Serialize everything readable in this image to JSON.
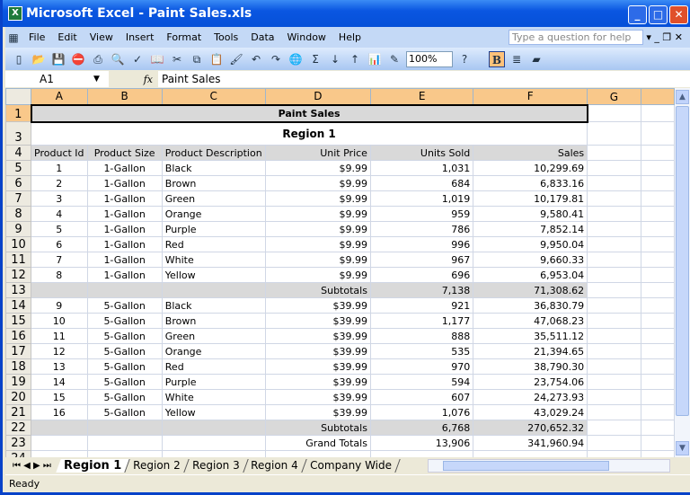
{
  "window": {
    "title": "Microsoft Excel - Paint Sales.xls"
  },
  "menu": [
    "File",
    "Edit",
    "View",
    "Insert",
    "Format",
    "Tools",
    "Data",
    "Window",
    "Help"
  ],
  "help_placeholder": "Type a question for help",
  "toolbar": {
    "zoom": "100%",
    "bold": "B"
  },
  "formula_bar": {
    "name_box": "A1",
    "fx": "fx",
    "content": "Paint Sales"
  },
  "columns": [
    "A",
    "B",
    "C",
    "D",
    "E",
    "F",
    "G"
  ],
  "sheet": {
    "title": "Paint Sales",
    "subtitle": "Region 1",
    "headers": [
      "Product Id",
      "Product Size",
      "Product Description",
      "Unit Price",
      "Units Sold",
      "Sales"
    ],
    "rows": [
      [
        "1",
        "1-Gallon",
        "Black",
        "$9.99",
        "1,031",
        "10,299.69"
      ],
      [
        "2",
        "1-Gallon",
        "Brown",
        "$9.99",
        "684",
        "6,833.16"
      ],
      [
        "3",
        "1-Gallon",
        "Green",
        "$9.99",
        "1,019",
        "10,179.81"
      ],
      [
        "4",
        "1-Gallon",
        "Orange",
        "$9.99",
        "959",
        "9,580.41"
      ],
      [
        "5",
        "1-Gallon",
        "Purple",
        "$9.99",
        "786",
        "7,852.14"
      ],
      [
        "6",
        "1-Gallon",
        "Red",
        "$9.99",
        "996",
        "9,950.04"
      ],
      [
        "7",
        "1-Gallon",
        "White",
        "$9.99",
        "967",
        "9,660.33"
      ],
      [
        "8",
        "1-Gallon",
        "Yellow",
        "$9.99",
        "696",
        "6,953.04"
      ],
      [
        "",
        "",
        "",
        "Subtotals",
        "7,138",
        "71,308.62"
      ],
      [
        "9",
        "5-Gallon",
        "Black",
        "$39.99",
        "921",
        "36,830.79"
      ],
      [
        "10",
        "5-Gallon",
        "Brown",
        "$39.99",
        "1,177",
        "47,068.23"
      ],
      [
        "11",
        "5-Gallon",
        "Green",
        "$39.99",
        "888",
        "35,511.12"
      ],
      [
        "12",
        "5-Gallon",
        "Orange",
        "$39.99",
        "535",
        "21,394.65"
      ],
      [
        "13",
        "5-Gallon",
        "Red",
        "$39.99",
        "970",
        "38,790.30"
      ],
      [
        "14",
        "5-Gallon",
        "Purple",
        "$39.99",
        "594",
        "23,754.06"
      ],
      [
        "15",
        "5-Gallon",
        "White",
        "$39.99",
        "607",
        "24,273.93"
      ],
      [
        "16",
        "5-Gallon",
        "Yellow",
        "$39.99",
        "1,076",
        "43,029.24"
      ],
      [
        "",
        "",
        "",
        "Subtotals",
        "6,768",
        "270,652.32"
      ],
      [
        "",
        "",
        "",
        "Grand Totals",
        "13,906",
        "341,960.94"
      ]
    ]
  },
  "tabs": [
    "Region 1",
    "Region 2",
    "Region 3",
    "Region 4",
    "Company Wide"
  ],
  "status": "Ready"
}
